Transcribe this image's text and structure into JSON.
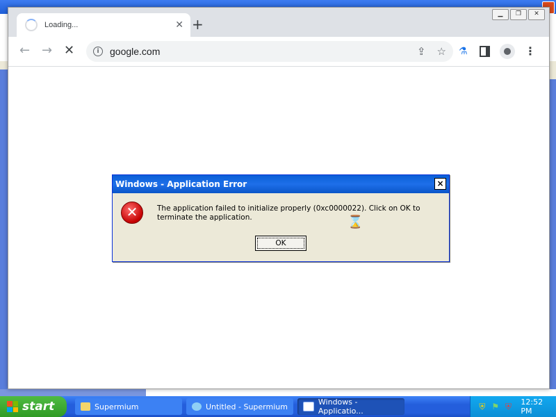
{
  "browser": {
    "tab_title": "Loading...",
    "url": "google.com",
    "window_buttons": [
      "minimize",
      "restore",
      "close"
    ]
  },
  "dialog": {
    "title": "Windows - Application Error",
    "close_label": "×",
    "message": "The application failed to initialize properly (0xc0000022). Click on OK to terminate the application.",
    "ok_label": "OK",
    "icon": "error-icon"
  },
  "taskbar": {
    "start_label": "start",
    "items": [
      {
        "label": "Supermium",
        "icon": "folder-icon"
      },
      {
        "label": "Untitled - Supermium",
        "icon": "browser-icon"
      },
      {
        "label": "Windows - Applicatio...",
        "icon": "window-icon",
        "active": true
      }
    ],
    "clock": "12:52 PM"
  },
  "colors": {
    "xp_blue": "#245edc",
    "start_green": "#2f9a25",
    "dialog_bg": "#ece9d8"
  }
}
